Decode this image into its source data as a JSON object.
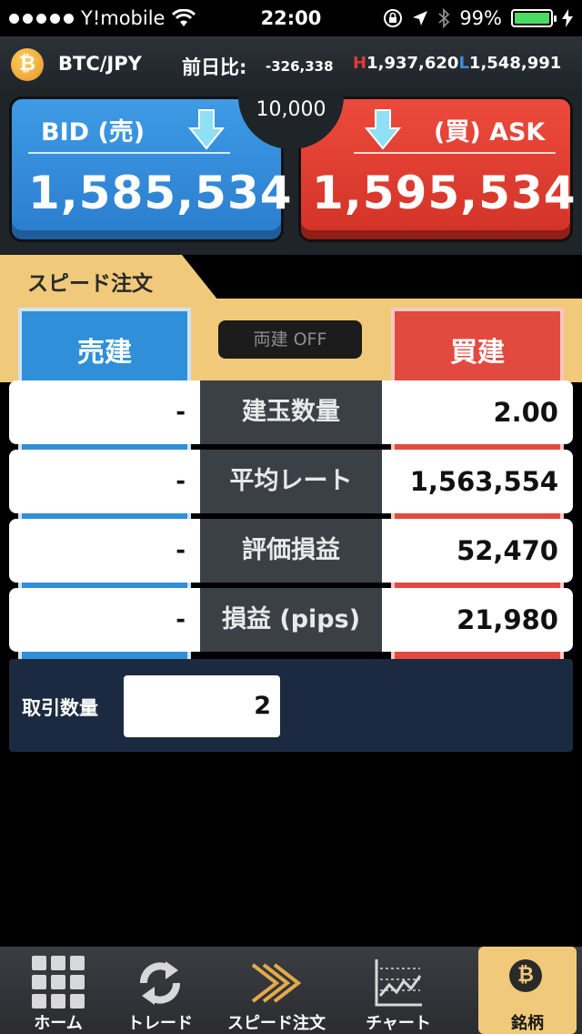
{
  "status_bar": {
    "carrier": "Y!mobile",
    "time": "22:00",
    "battery": "99%",
    "battery_level": 0.99,
    "icons": [
      "signal-dots-icon",
      "wifi-icon",
      "orientation-lock-icon",
      "location-arrow-icon",
      "bluetooth-icon",
      "battery-icon",
      "charging-bolt-icon"
    ]
  },
  "header": {
    "coin_symbol": "₿",
    "pair": "BTC/JPY",
    "change_label": "前日比:",
    "change_value": "-326,338",
    "high_marker": "H",
    "high_value": "1,937,620",
    "low_marker": "L",
    "low_value": "1,548,991"
  },
  "prices": {
    "bid_label": "BID (売)",
    "bid_price": "1,585,534",
    "ask_label": "(買) ASK",
    "ask_price": "1,595,534",
    "spread": "10,000"
  },
  "speed_order": {
    "tab_label": "スピード注文",
    "sell_button": "売建",
    "buy_button": "買建",
    "hedge_toggle": "両建 OFF"
  },
  "positions": {
    "rows": [
      {
        "left": "-",
        "label": "建玉数量",
        "right": "2.00"
      },
      {
        "left": "-",
        "label": "平均レート",
        "right": "1,563,554"
      },
      {
        "left": "-",
        "label": "評価損益",
        "right": "52,470"
      },
      {
        "left": "-",
        "label": "損益 (pips)",
        "right": "21,980"
      }
    ]
  },
  "quantity": {
    "label": "取引数量",
    "value": "2"
  },
  "nav": {
    "items": [
      {
        "label": "ホーム",
        "icon": "grid-home-icon"
      },
      {
        "label": "トレード",
        "icon": "refresh-trade-icon"
      },
      {
        "label": "スピード注文",
        "icon": "speed-arrows-icon"
      },
      {
        "label": "チャート",
        "icon": "chart-icon"
      },
      {
        "label": "銘柄",
        "icon": "bitcoin-coin-icon",
        "active": true
      }
    ]
  },
  "colors": {
    "bid_blue": "#2a7dcd",
    "ask_red": "#d23327",
    "gold": "#f0c97a",
    "panel_dark": "#1f2429",
    "qty_navy": "#1b2a40"
  }
}
